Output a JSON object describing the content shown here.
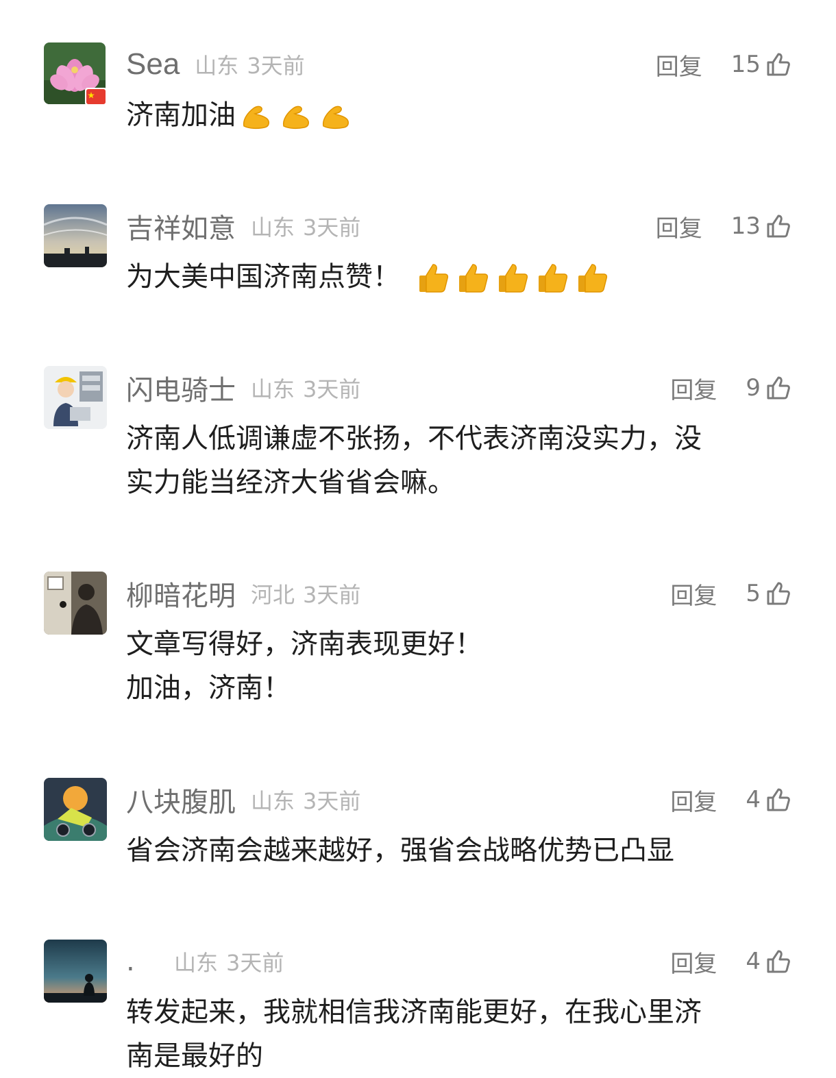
{
  "reply_label": "回复",
  "accent_color": "#f5b21b",
  "comments": [
    {
      "nickname": "Sea",
      "location": "山东",
      "time": "3天前",
      "likes": "15",
      "text": "济南加油",
      "emoji": [
        "flexed-biceps",
        "flexed-biceps",
        "flexed-biceps"
      ],
      "avatar": "lotus-flower-avatar",
      "badge": "china-flag-badge"
    },
    {
      "nickname": "吉祥如意",
      "location": "山东",
      "time": "3天前",
      "likes": "13",
      "text": "为大美中国济南点赞！",
      "emoji": [
        "thumbs-up",
        "thumbs-up",
        "thumbs-up",
        "thumbs-up",
        "thumbs-up"
      ],
      "avatar": "sunset-sky-avatar"
    },
    {
      "nickname": "闪电骑士",
      "location": "山东",
      "time": "3天前",
      "likes": "9",
      "lines": [
        "济南人低调谦虚不张扬，不代表济南没实力，没",
        "实力能当经济大省省会嘛。"
      ],
      "avatar": "worker-cartoon-avatar"
    },
    {
      "nickname": "柳暗花明",
      "location": "河北",
      "time": "3天前",
      "likes": "5",
      "lines": [
        "文章写得好，济南表现更好！",
        "加油，济南！"
      ],
      "avatar": "person-photo-avatar"
    },
    {
      "nickname": "八块腹肌",
      "location": "山东",
      "time": "3天前",
      "likes": "4",
      "lines": [
        "省会济南会越来越好，强省会战略优势已凸显"
      ],
      "avatar": "game-art-avatar"
    },
    {
      "nickname": ".",
      "location": "山东",
      "time": "3天前",
      "likes": "4",
      "lines": [
        "转发起来，我就相信我济南能更好，在我心里济",
        "南是最好的"
      ],
      "avatar": "silhouette-sunset-avatar"
    }
  ]
}
